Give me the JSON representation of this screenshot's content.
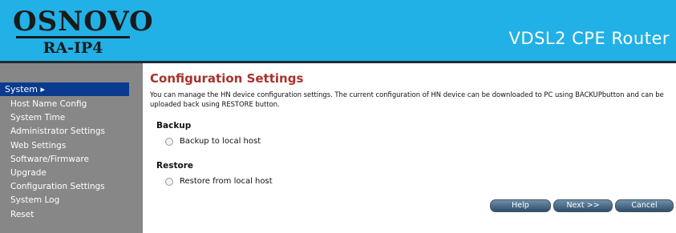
{
  "header": {
    "logo_main": "OSNOVO",
    "logo_sub": "RA-IP4",
    "product_name": "VDSL2 CPE Router"
  },
  "sidebar": {
    "selected": "System ▸",
    "items": [
      "Host Name Config",
      "System Time",
      "Administrator Settings",
      "Web Settings",
      "Software/Firmware",
      "Upgrade",
      "Configuration Settings",
      "System Log",
      "Reset"
    ]
  },
  "main": {
    "title": "Configuration Settings",
    "description": "You can manage the HN device configuration settings. The current configuration of HN device can be downloaded to PC using BACKUPbutton and can be uploaded back using RESTORE button.",
    "backup": {
      "heading": "Backup",
      "option_label": "Backup to local host"
    },
    "restore": {
      "heading": "Restore",
      "option_label": "Restore from local host"
    }
  },
  "buttons": {
    "help": "Help",
    "next": "Next >>",
    "cancel": "Cancel"
  },
  "colors": {
    "header_bg": "#21b1e6",
    "sidebar_bg": "#878787",
    "sidebar_selected_bg": "#0a3b8e",
    "title": "#a8322b"
  }
}
